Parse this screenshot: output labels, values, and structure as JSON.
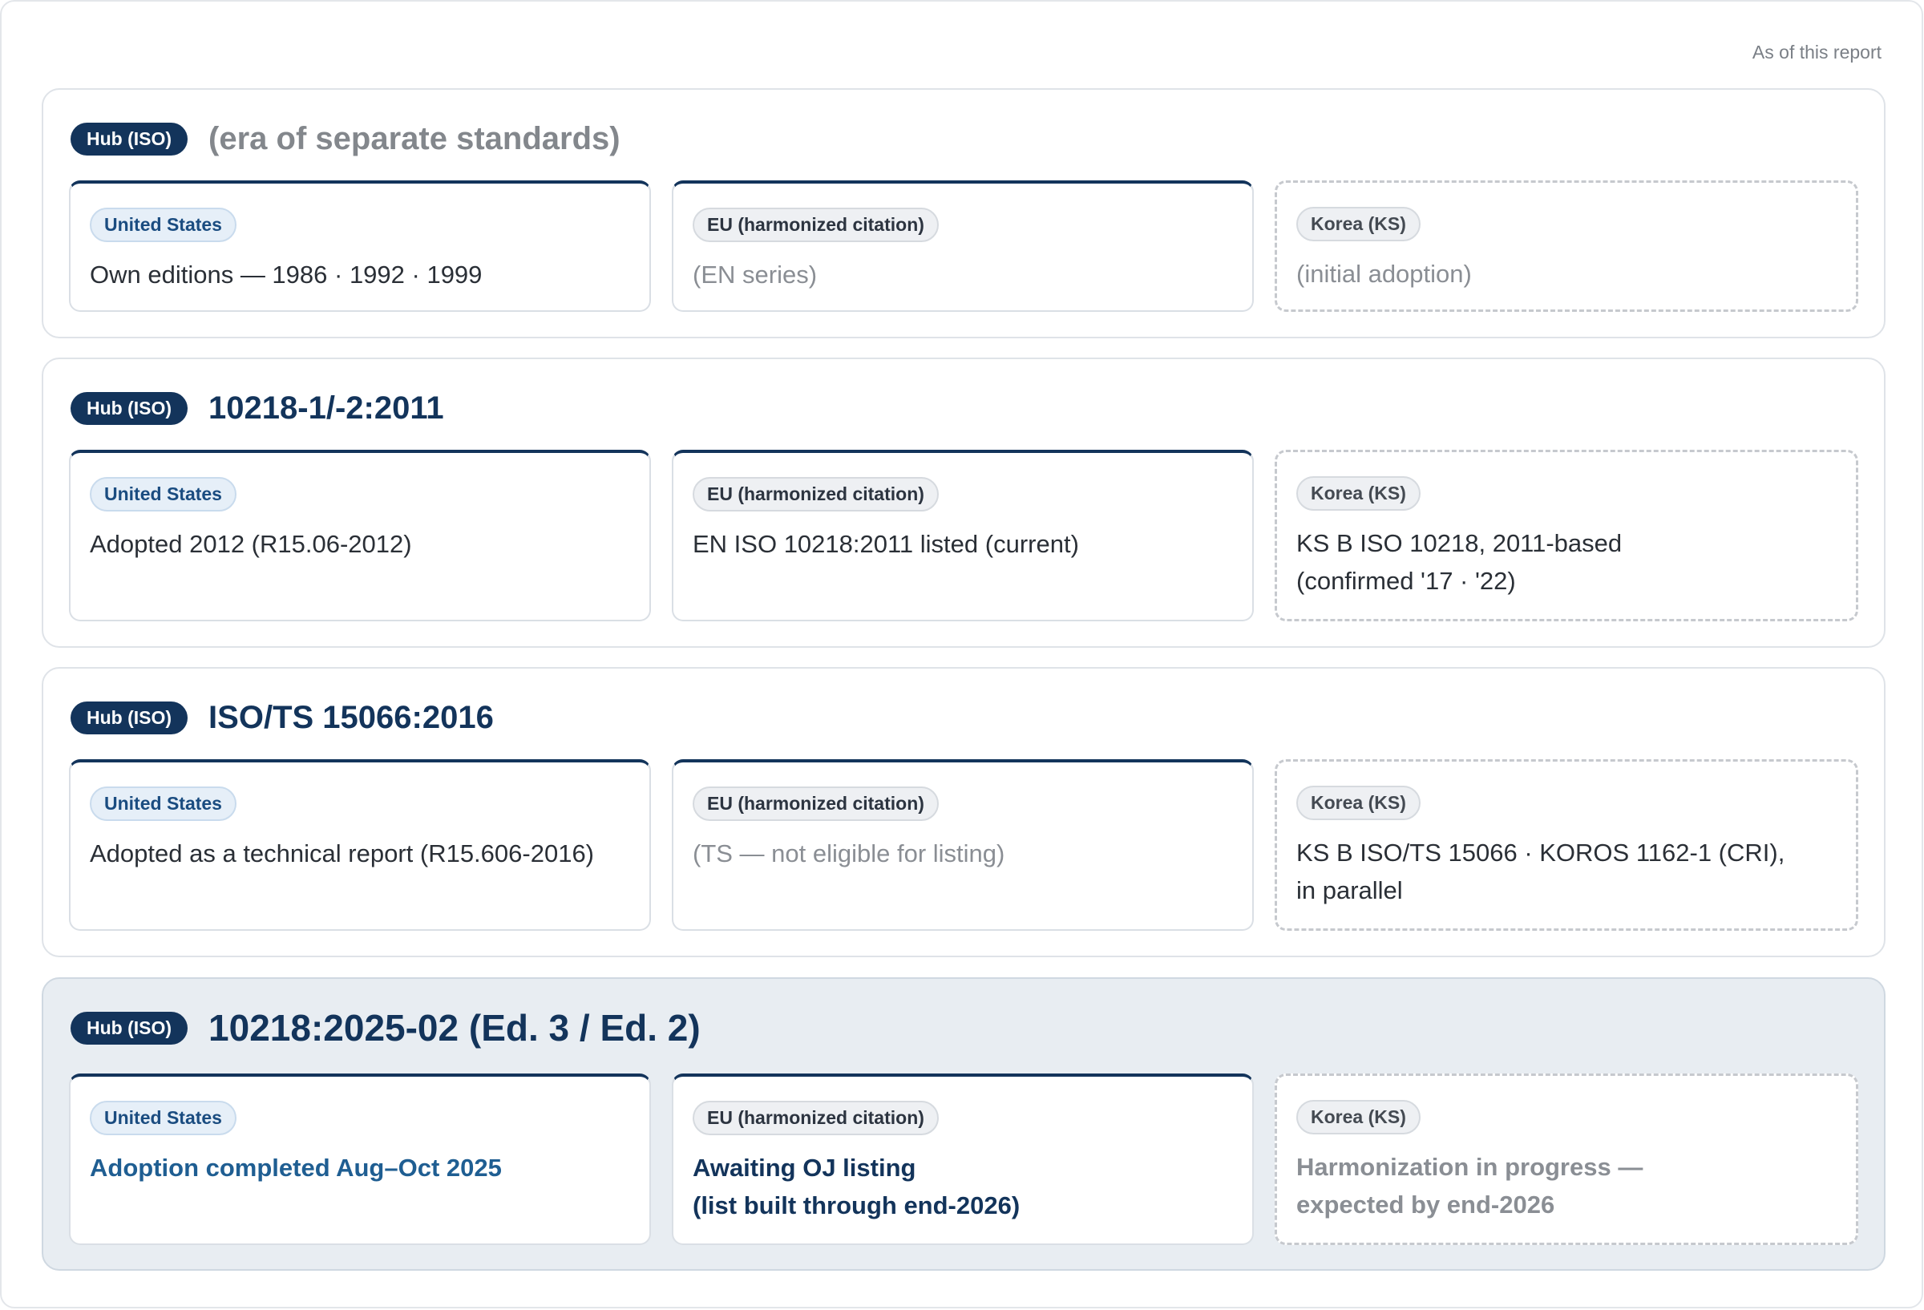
{
  "asof": "As of this report",
  "hub_label": "Hub (ISO)",
  "jurisdictions": {
    "us": "United States",
    "eu": "EU (harmonized citation)",
    "kr": "Korea (KS)"
  },
  "eras": [
    {
      "title": "(era of separate standards)",
      "us": "Own editions — 1986 · 1992 · 1999",
      "eu": "(EN series)",
      "kr": "(initial adoption)"
    },
    {
      "title": "10218-1/-2:2011",
      "us": "Adopted 2012 (R15.06-2012)",
      "eu": "EN ISO 10218:2011 listed (current)",
      "kr": "KS B ISO 10218, 2011-based\n(confirmed '17 · '22)"
    },
    {
      "title": "ISO/TS 15066:2016",
      "us": "Adopted as a technical report (R15.606-2016)",
      "eu": "(TS — not eligible for listing)",
      "kr": "KS B ISO/TS 15066 · KOROS 1162-1 (CRI),\nin parallel"
    },
    {
      "title": "10218:2025-02 (Ed. 3 / Ed. 2)",
      "us": "Adoption completed Aug–Oct 2025",
      "eu": "Awaiting OJ listing\n(list built through end-2026)",
      "kr": "Harmonization in progress —\nexpected by end-2026"
    }
  ]
}
